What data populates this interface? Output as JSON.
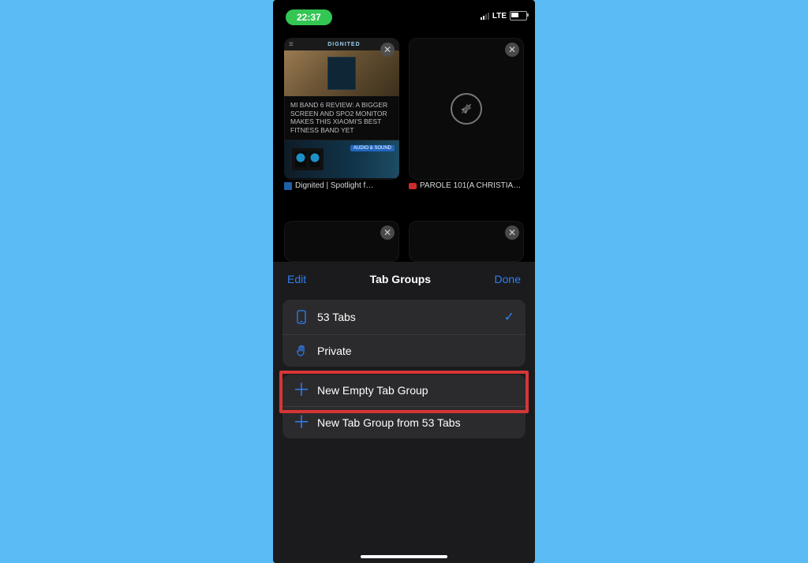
{
  "status_bar": {
    "time": "22:37",
    "carrier_label": "LTE"
  },
  "tab_grid": {
    "tabs": [
      {
        "site_brand": "DIGNITED",
        "article_title": "MI BAND 6 REVIEW: A BIGGER SCREEN AND SPO2 MONITOR MAKES THIS XIAOMI'S BEST FITNESS BAND YET",
        "strip_tag": "AUDIO & SOUND",
        "caption": "Dignited | Spotlight f…"
      },
      {
        "caption": "PAROLE 101(A CHRISTIA…"
      }
    ]
  },
  "sheet": {
    "edit": "Edit",
    "title": "Tab Groups",
    "done": "Done"
  },
  "groups": {
    "tabs_count": "53 Tabs",
    "private": "Private",
    "new_empty": "New Empty Tab Group",
    "new_from": "New Tab Group from 53 Tabs"
  },
  "icons": {
    "close": "✕",
    "check": "✓",
    "plus": "＋",
    "hamburger": "≡"
  }
}
